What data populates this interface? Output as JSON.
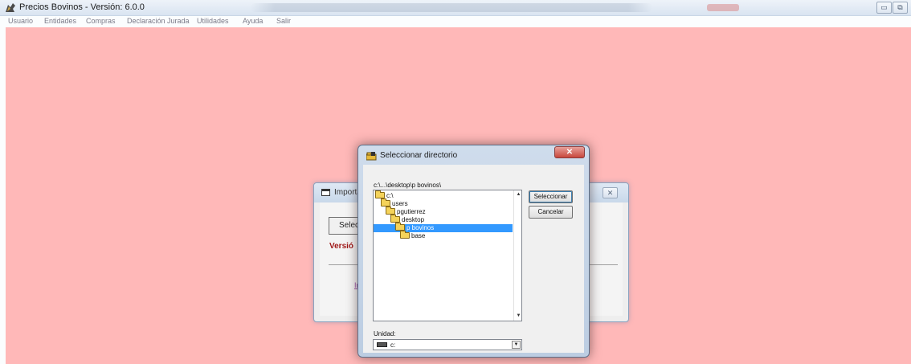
{
  "window": {
    "title": "Precios Bovinos - Versión: 6.0.0",
    "minimize_symbol": "▭",
    "restore_symbol": "⧉"
  },
  "menu": [
    "Usuario",
    "Entidades",
    "Compras",
    "Declaración Jurada",
    "Utilidades",
    "Ayuda",
    "Salir"
  ],
  "colors": {
    "workspace": "#ffb8b8",
    "selection": "#3399ff",
    "version_text": "#a01818"
  },
  "back_dialog": {
    "title": "Importa",
    "select_button": "Selecc",
    "version_label": "Versió",
    "import_link": "Imp",
    "close_symbol": "✕"
  },
  "select_dir_dialog": {
    "title": "Seleccionar directorio",
    "close_symbol": "✕",
    "current_path": "c:\\...\\desktop\\p bovinos\\",
    "tree": [
      {
        "label": "c:\\",
        "level": 0,
        "selected": false
      },
      {
        "label": "users",
        "level": 1,
        "selected": false
      },
      {
        "label": "pgutierrez",
        "level": 2,
        "selected": false
      },
      {
        "label": "desktop",
        "level": 3,
        "selected": false
      },
      {
        "label": "p bovinos",
        "level": 4,
        "selected": true
      },
      {
        "label": "base",
        "level": 5,
        "selected": false
      }
    ],
    "select_button": "Seleccionar",
    "cancel_button": "Cancelar",
    "drive_label": "Unidad:",
    "drive_value": "c:",
    "scroll_up": "▲",
    "scroll_down": "▼",
    "dropdown_arrow": "▼"
  }
}
